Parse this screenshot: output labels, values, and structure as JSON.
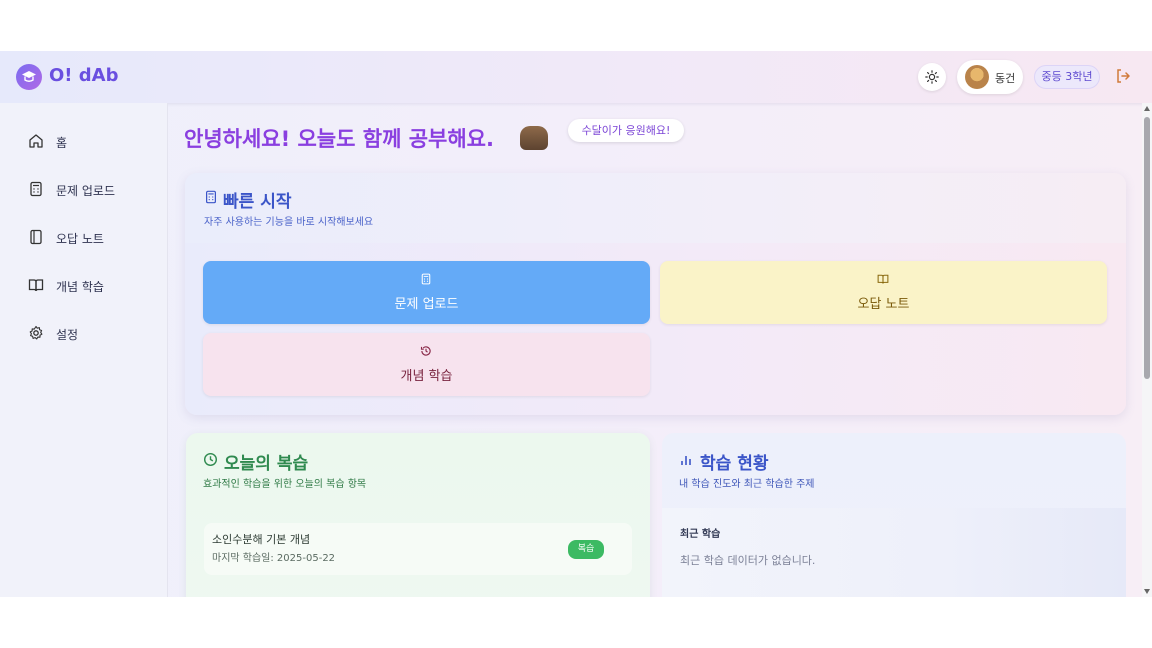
{
  "app": {
    "name": "O! dAb"
  },
  "header": {
    "user_name": "동건",
    "grade": "중등 3학년",
    "icons": [
      "logo-cap-icon",
      "sun-icon",
      "avatar-image",
      "logout-icon"
    ]
  },
  "sidebar": {
    "items": [
      {
        "label": "홈",
        "icon": "home-icon"
      },
      {
        "label": "문제 업로드",
        "icon": "calculator-icon"
      },
      {
        "label": "오답 노트",
        "icon": "notebook-icon"
      },
      {
        "label": "개념 학습",
        "icon": "book-open-icon"
      },
      {
        "label": "설정",
        "icon": "gear-icon"
      }
    ]
  },
  "main": {
    "greeting": "안녕하세요! 오늘도 함께 공부해요.",
    "cheer": "수달이가 응원해요!",
    "quick": {
      "title": "빠른 시작",
      "subtitle": "자주 사용하는 기능을 바로 시작해보세요",
      "buttons": [
        {
          "label": "문제 업로드",
          "icon": "calculator-icon",
          "color": "#64aaf7"
        },
        {
          "label": "오답 노트",
          "icon": "book-open-icon",
          "color": "#faf3c8"
        },
        {
          "label": "개념 학습",
          "icon": "history-icon",
          "color": "#f7e3ee"
        }
      ]
    },
    "review": {
      "title": "오늘의 복습",
      "subtitle": "효과적인 학습을 위한 오늘의 복습 항목",
      "items": [
        {
          "topic": "소인수분해 기본 개념",
          "date": "마지막 학습일: 2025-05-22",
          "badge": "복습"
        }
      ]
    },
    "status": {
      "title": "학습 현황",
      "subtitle": "내 학습 진도와 최근 학습한 주제",
      "recent_title": "최근 학습",
      "recent_empty": "최근 학습 데이터가 없습니다."
    }
  },
  "colors": {
    "brand": "#6a4fe0",
    "greeting": "#8a3fe0",
    "review_green": "#2f8a4f",
    "status_blue": "#3b55c8"
  }
}
